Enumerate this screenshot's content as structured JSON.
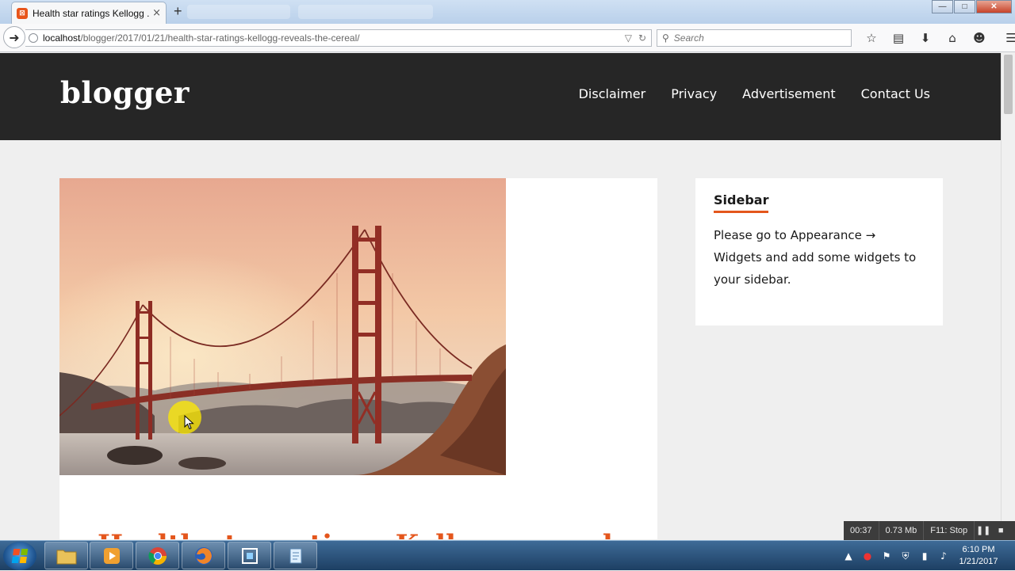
{
  "browser": {
    "tab_title": "Health star ratings Kellogg ...",
    "tab_close": "×",
    "new_tab": "+",
    "url_host": "localhost",
    "url_path": "/blogger/2017/01/21/health-star-ratings-kellogg-reveals-the-cereal/",
    "search_placeholder": "Search",
    "window_controls": {
      "minimize": "—",
      "maximize": "□",
      "close": "✕"
    }
  },
  "site": {
    "logo": "blogger",
    "nav": [
      "Disclaimer",
      "Privacy",
      "Advertisement",
      "Contact Us"
    ]
  },
  "article": {
    "title": "Health star ratings Kellogg reveals",
    "image_subject": "golden-gate-bridge-sunset"
  },
  "sidebar": {
    "title": "Sidebar",
    "text": "Please go to Appearance → Widgets and add some widgets to your sidebar."
  },
  "recorder": {
    "elapsed": "00:37",
    "size": "0.73 Mb",
    "hotkey": "F11: Stop"
  },
  "taskbar": {
    "time": "6:10 PM",
    "date": "1/21/2017"
  },
  "colors": {
    "accent": "#e4561c",
    "header_bg": "#262626",
    "page_bg": "#efefef"
  }
}
